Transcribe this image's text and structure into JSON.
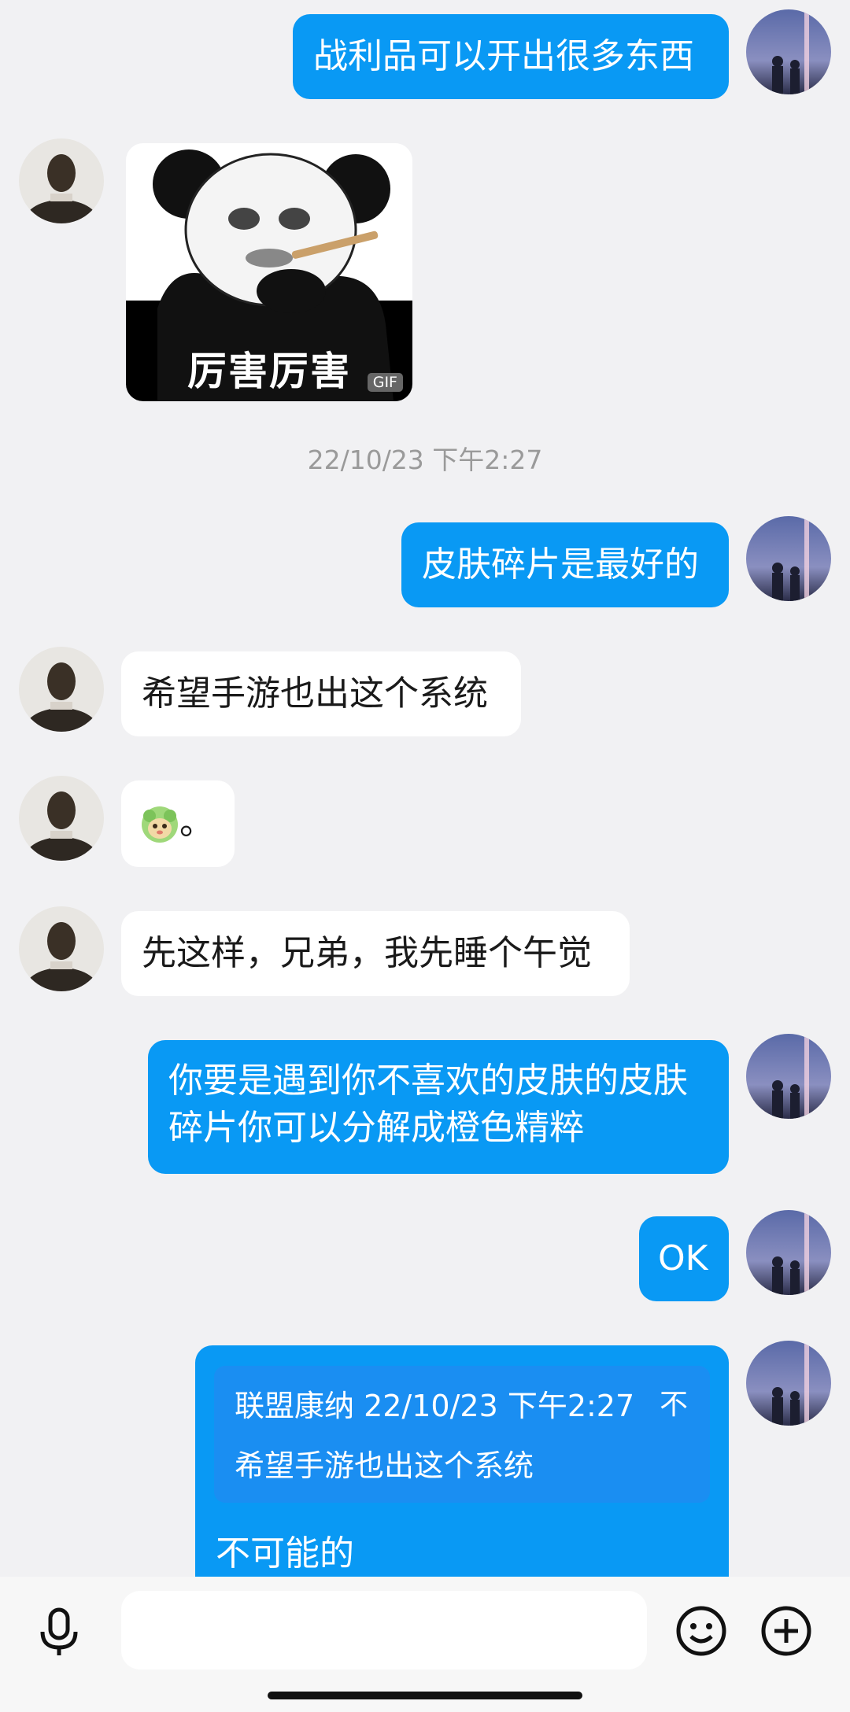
{
  "messages": {
    "m1": "战利品可以开出很多东西",
    "sticker_caption": "厉害厉害",
    "sticker_badge": "GIF",
    "timestamp": "22/10/23 下午2:27",
    "m2": "皮肤碎片是最好的",
    "m3": "希望手游也出这个系统",
    "m4_suffix": "。",
    "m5": "先这样，兄弟，我先睡个午觉",
    "m6_line1": "你要是遇到你不喜欢的皮肤的皮肤",
    "m6_line2": "碎片你可以分解成橙色精粹",
    "m7": "OK",
    "m8_quote_head": "联盟康纳 22/10/23 下午2:27",
    "m8_quote_action": "不",
    "m8_quote_text": "希望手游也出这个系统",
    "m8_reply": "不可能的"
  },
  "colors": {
    "outgoing_bubble": "#0999f4",
    "incoming_bubble": "#ffffff",
    "background": "#f1f1f3"
  },
  "icons": {
    "voice": "microphone-icon",
    "emoji": "emoji-icon",
    "more": "plus-circle-icon"
  }
}
